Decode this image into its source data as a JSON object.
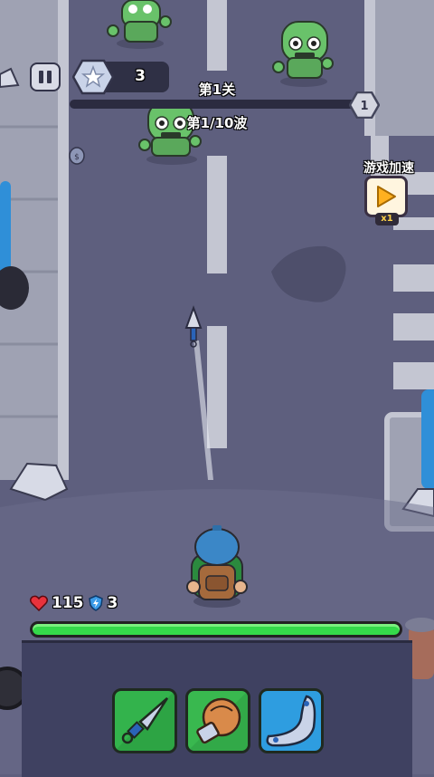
{
  "hud": {
    "gem_count": "3",
    "level_title": "第1关",
    "wave_text": "第1/10波",
    "next_level_badge": "1",
    "speed_label": "游戏加速",
    "speed_multiplier": "x1"
  },
  "player": {
    "hp": "115",
    "shield": "3",
    "hp_fraction": 1.0
  },
  "level_progress_fraction": 0.0,
  "weapon_slots": [
    {
      "name": "kunai-dagger-icon",
      "color": "#33b34c"
    },
    {
      "name": "boxing-glove-icon",
      "color": "#39b84f"
    },
    {
      "name": "boomerang-icon",
      "color": "#2e9de0"
    }
  ],
  "colors": {
    "road": "#5e5f7e",
    "sidewalk": "#a3a6b6",
    "hp_bar": "#35d94a",
    "zombie": "#69c26a"
  }
}
